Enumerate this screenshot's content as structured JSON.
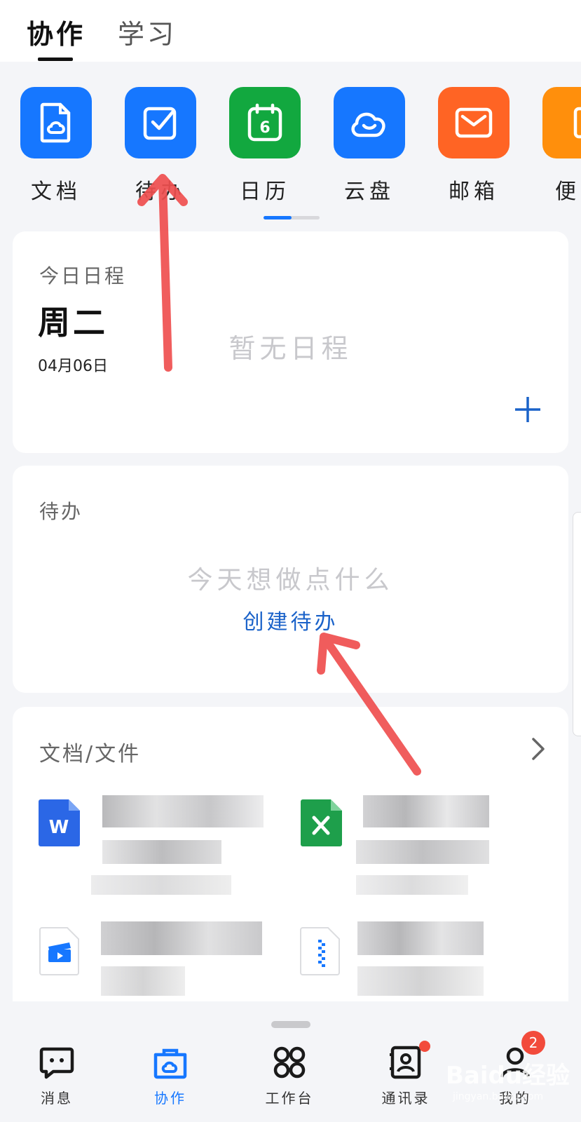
{
  "top_tabs": {
    "active": "协作",
    "inactive": "学习"
  },
  "apps": [
    {
      "label": "文档",
      "icon": "document-icon",
      "color": "#1677ff"
    },
    {
      "label": "待办",
      "icon": "todo-check-icon",
      "color": "#1677ff"
    },
    {
      "label": "日历",
      "icon": "calendar-icon",
      "color": "#12a83f",
      "day": "6"
    },
    {
      "label": "云盘",
      "icon": "cloud-drive-icon",
      "color": "#1677ff"
    },
    {
      "label": "邮箱",
      "icon": "mail-icon",
      "color": "#ff6424"
    },
    {
      "label": "便",
      "icon": "notes-icon",
      "color": "#ff8f0c"
    }
  ],
  "schedule": {
    "title": "今日日程",
    "weekday": "周二",
    "date": "04月06日",
    "empty": "暂无日程"
  },
  "todo": {
    "title": "待办",
    "empty": "今天想做点什么",
    "create": "创建待办"
  },
  "files": {
    "title": "文档/文件",
    "items": [
      {
        "icon": "word-file-icon",
        "color": "#2b67e6"
      },
      {
        "icon": "excel-file-icon",
        "color": "#1e9f4b"
      },
      {
        "icon": "video-file-icon",
        "color": "#1677ff"
      },
      {
        "icon": "zip-file-icon",
        "color": "#1677ff"
      }
    ]
  },
  "bottom_nav": [
    {
      "label": "消息",
      "icon": "message-icon"
    },
    {
      "label": "协作",
      "icon": "collab-icon",
      "active": true
    },
    {
      "label": "工作台",
      "icon": "workbench-icon"
    },
    {
      "label": "通讯录",
      "icon": "contacts-icon",
      "dot": true
    },
    {
      "label": "我的",
      "icon": "profile-icon",
      "badge": "2"
    }
  ],
  "watermark": {
    "text": "Baidu经验",
    "sub": "jingyan.baidu.com"
  },
  "accent": "#1677ff"
}
